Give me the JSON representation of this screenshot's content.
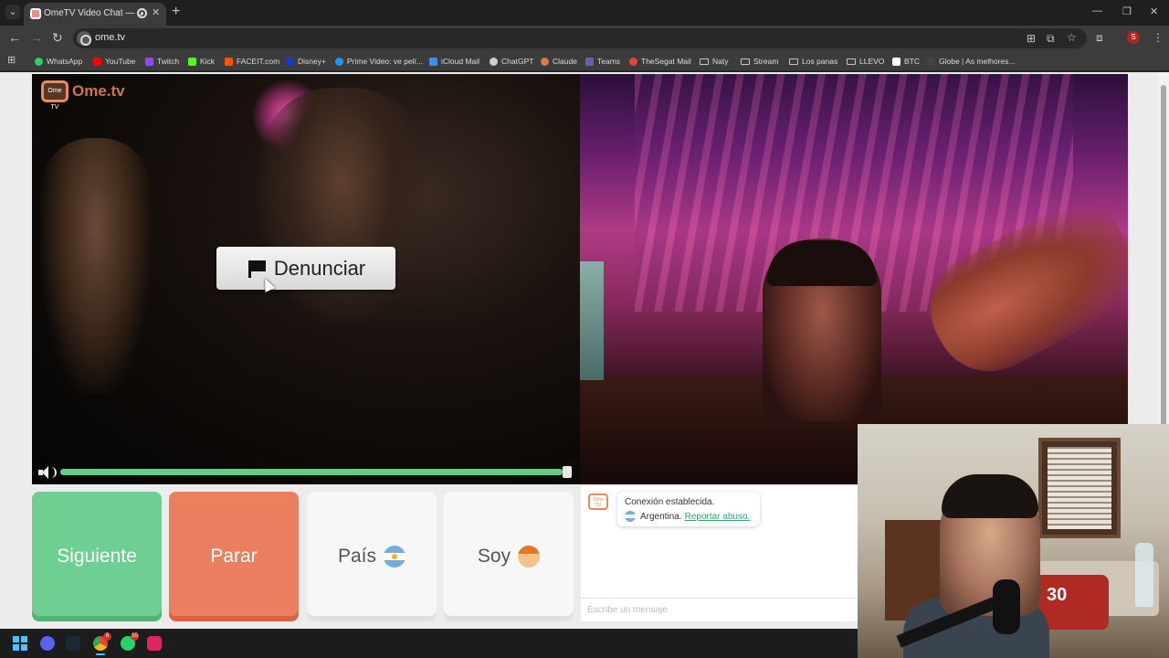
{
  "browser": {
    "tab_title": "OmeTV Video Chat — Omegle",
    "url": "ome.tv",
    "profile_initial": "S",
    "bookmarks": [
      {
        "label": "WhatsApp",
        "color": "#25d366"
      },
      {
        "label": "YouTube",
        "color": "#ff0000"
      },
      {
        "label": "Twitch",
        "color": "#9146ff"
      },
      {
        "label": "Kick",
        "color": "#53fc18"
      },
      {
        "label": "FACEIT.com",
        "color": "#ff5500"
      },
      {
        "label": "Disney+",
        "color": "#113ccf"
      },
      {
        "label": "Prime Video: ve pelí...",
        "color": "#1a98ff"
      },
      {
        "label": "iCloud Mail",
        "color": "#3a8ef6"
      },
      {
        "label": "ChatGPT",
        "color": "#cfcfcf"
      },
      {
        "label": "Claude",
        "color": "#d97757"
      },
      {
        "label": "Teams",
        "color": "#6264a7"
      },
      {
        "label": "TheSegat Mail",
        "color": "#ea4335"
      }
    ],
    "bookmark_folders": [
      "Naty",
      "Stream",
      "Los panas",
      "LLEVO"
    ],
    "bookmarks_tail": [
      {
        "label": "BTC",
        "color": "#ffffff"
      },
      {
        "label": "Globe | As melhores...",
        "color": "#444444"
      }
    ]
  },
  "video": {
    "report_label": "Denunciar",
    "logo_text": "Ome.tv",
    "logo_badge": "Ome TV",
    "volume_level": 0.99
  },
  "controls": {
    "next_label": "Siguiente",
    "stop_label": "Parar",
    "country_label": "País",
    "iam_label": "Soy"
  },
  "chat": {
    "logo_badge": "Ome TV",
    "status": "Conexión establecida.",
    "country": "Argentina.",
    "report_link": "Reportar abuso.",
    "input_placeholder": "Escribe un mensaje"
  },
  "overlay": {
    "shirt_number": "30"
  },
  "taskbar": {
    "chrome_badge": "6",
    "whatsapp_badge": "10"
  }
}
